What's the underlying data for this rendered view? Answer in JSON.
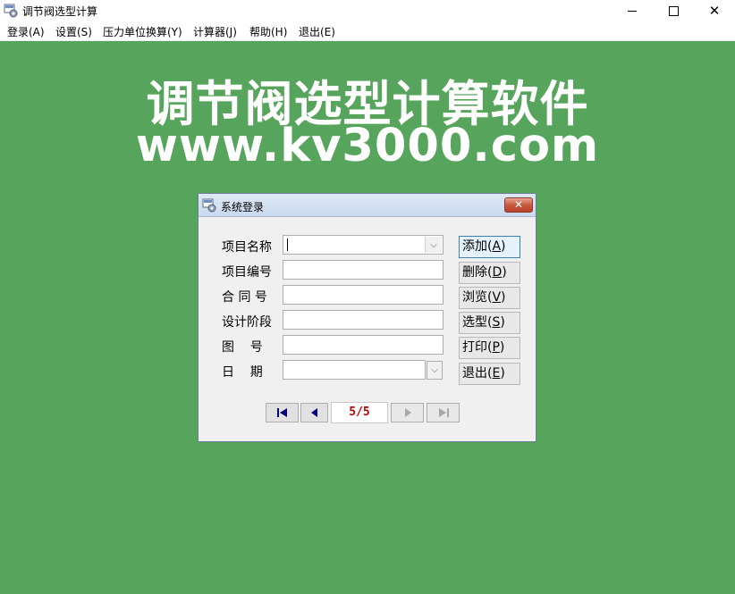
{
  "window": {
    "title": "调节阀选型计算",
    "controls": {
      "minimize": "─",
      "maximize": "☐",
      "close": "✕"
    }
  },
  "menu": [
    {
      "label": "登录(A)"
    },
    {
      "label": "设置(S)"
    },
    {
      "label": "压力单位换算(Y)"
    },
    {
      "label": "计算器(J)"
    },
    {
      "label": "帮助(H)"
    },
    {
      "label": "退出(E)"
    }
  ],
  "headline": {
    "title": "调节阀选型计算软件",
    "url": "www.kv3000.com"
  },
  "dialog": {
    "title": "系统登录",
    "close_label": "✕",
    "fields": [
      {
        "label": "项目名称",
        "value": "",
        "type": "combo"
      },
      {
        "label": "项目编号",
        "value": ""
      },
      {
        "label": "合 同 号",
        "value": ""
      },
      {
        "label": "设计阶段",
        "value": ""
      },
      {
        "label": "图    号",
        "value": ""
      },
      {
        "label": "日    期",
        "value": "",
        "type": "date"
      }
    ],
    "buttons": [
      {
        "text": "添加(",
        "key": "A",
        "end": ")"
      },
      {
        "text": "删除(",
        "key": "D",
        "end": ")"
      },
      {
        "text": "浏览(",
        "key": "V",
        "end": ")"
      },
      {
        "text": "选型(",
        "key": "S",
        "end": ")"
      },
      {
        "text": "打印(",
        "key": "P",
        "end": ")"
      },
      {
        "text": "退出(",
        "key": "E",
        "end": ")"
      }
    ],
    "pager": {
      "indicator": "5/5"
    }
  },
  "colors": {
    "background": "#57a55c",
    "pager_text": "#c00000",
    "nav_arrow": "#000080"
  }
}
